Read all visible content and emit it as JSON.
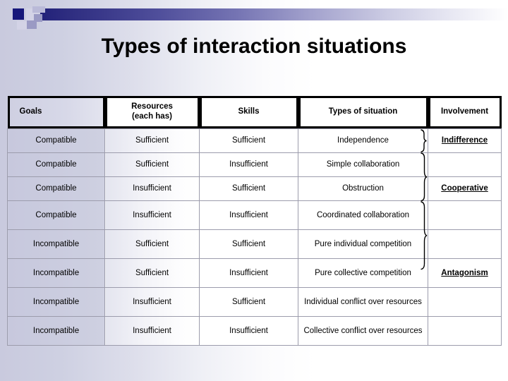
{
  "slide": {
    "title": "Types of interaction situations",
    "background_gradient_from": "#c9cade",
    "background_gradient_to": "#ffffff",
    "accent_color": "#22217a"
  },
  "table": {
    "headers": [
      {
        "label": "Goals",
        "align": "left",
        "shaded": true
      },
      {
        "label": "Resources\n(each has)",
        "line1": "Resources",
        "line2": "(each has)",
        "align": "center",
        "shaded": false
      },
      {
        "label": "Skills",
        "align": "center",
        "shaded": false
      },
      {
        "label": "Types of situation",
        "align": "center",
        "shaded": false
      },
      {
        "label": "Involvement",
        "align": "center",
        "shaded": false
      }
    ],
    "rows": [
      {
        "goals": "Compatible",
        "resources": "Sufficient",
        "skills": "Sufficient",
        "situation": "Independence",
        "involvement": "Indifference"
      },
      {
        "goals": "Compatible",
        "resources": "Sufficient",
        "skills": "Insufficient",
        "situation": "Simple collaboration",
        "involvement": ""
      },
      {
        "goals": "Compatible",
        "resources": "Insufficient",
        "skills": "Sufficient",
        "situation": "Obstruction",
        "involvement": "Cooperative"
      },
      {
        "goals": "Compatible",
        "resources": "Insufficient",
        "skills": "Insufficient",
        "situation": "Coordinated collaboration",
        "involvement": ""
      },
      {
        "goals": "Incompatible",
        "resources": "Sufficient",
        "skills": "Sufficient",
        "situation": "Pure individual competition",
        "involvement": ""
      },
      {
        "goals": "Incompatible",
        "resources": "Sufficient",
        "skills": "Insufficient",
        "situation": "Pure collective competition",
        "involvement": "Antagonism"
      },
      {
        "goals": "Incompatible",
        "resources": "Insufficient",
        "skills": "Sufficient",
        "situation": "Individual conflict over resources",
        "involvement": ""
      },
      {
        "goals": "Incompatible",
        "resources": "Insufficient",
        "skills": "Insufficient",
        "situation": "Collective conflict over resources",
        "involvement": ""
      }
    ],
    "groupings": [
      {
        "label": "Indifference",
        "rows": [
          1,
          1
        ]
      },
      {
        "label": "Cooperative",
        "rows": [
          2,
          4
        ]
      },
      {
        "label": "Antagonism",
        "rows": [
          5,
          8
        ]
      }
    ]
  }
}
